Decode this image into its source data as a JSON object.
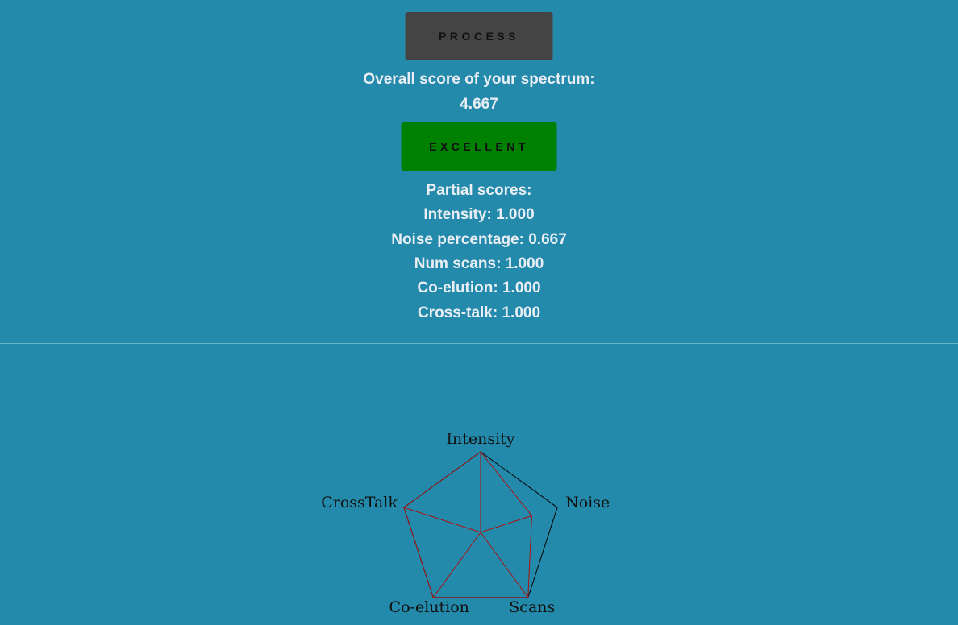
{
  "actions": {
    "process_label": "PROCESS"
  },
  "results": {
    "overall_label": "Overall score of your spectrum:",
    "overall_value": "4.667",
    "rating_label": "EXCELLENT",
    "rating_color": "#008000",
    "partial_title": "Partial scores:",
    "partials": [
      {
        "text": "Intensity: 1.000"
      },
      {
        "text": "Noise percentage: 0.667"
      },
      {
        "text": "Num scans: 1.000"
      },
      {
        "text": "Co-elution: 1.000"
      },
      {
        "text": "Cross-talk: 1.000"
      }
    ]
  },
  "chart_data": {
    "type": "radar",
    "axes": [
      "Intensity",
      "Noise",
      "Scans",
      "Co-elution",
      "CrossTalk"
    ],
    "max": 1.0,
    "series": [
      {
        "values": [
          1.0,
          0.667,
          1.0,
          1.0,
          1.0
        ],
        "color": "#aa1111"
      }
    ],
    "outline_color": "#000000"
  }
}
